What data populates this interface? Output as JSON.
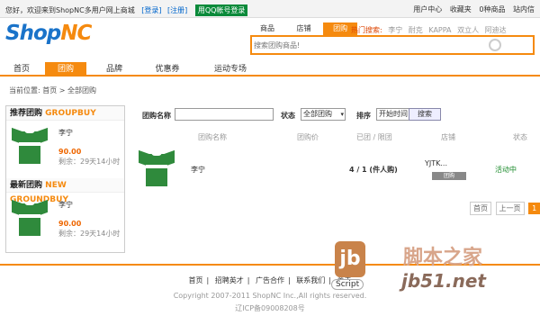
{
  "topbar": {
    "welcome": "您好，欢迎来到ShopNC多用户网上商城",
    "login": "[登录]",
    "register": "[注册]",
    "badge": "用QQ帐号登录",
    "right": [
      "用户中心",
      "收藏夹",
      "0种商品",
      "站内信"
    ]
  },
  "brand": {
    "logo_a": "Shop",
    "logo_b": "NC"
  },
  "search": {
    "tabs": [
      "商品",
      "店铺",
      "团购"
    ],
    "active_tab": "团购",
    "placeholder": "搜索团购商品!",
    "hot_label": "热门搜索:",
    "hot": [
      "李宁",
      "耐克",
      "KAPPA",
      "双立人",
      "阿迪达"
    ]
  },
  "nav": {
    "items": [
      "首页",
      "团购",
      "品牌",
      "优惠券",
      "运动专场"
    ],
    "active": "团购"
  },
  "crumb": "当前位置: 首页 > 全部团购",
  "sidebar": {
    "recommend": {
      "title": "推荐团购",
      "title_en": "GROUPBUY",
      "name": "李宁",
      "price": "90.00",
      "time": "剩余：29天14小时"
    },
    "latest": {
      "title": "最新团购",
      "title_en": "NEW GROUNDBUY",
      "name": "李宁",
      "price": "90.00",
      "time": "剩余：29天14小时"
    }
  },
  "filter": {
    "name_label": "团购名称",
    "status_label": "状态",
    "status_value": "全部团购",
    "sort_label": "排序",
    "sort_value": "开始时间",
    "search_button": "搜索"
  },
  "table": {
    "headers": [
      "团购名称",
      "团购价",
      "已团 / 限团",
      "店铺",
      "状态"
    ],
    "rows": [
      {
        "name": "李宁",
        "count": "4 / 1 (件人购)",
        "store": "YJTK...",
        "action": "团购",
        "status": "活动中"
      }
    ]
  },
  "pager": {
    "items": [
      "首页",
      "上一页"
    ],
    "current": "1"
  },
  "footer": {
    "links": [
      "首页",
      "招聘英才",
      "广告合作",
      "联系我们",
      "关于"
    ],
    "copyright": "Copyright 2007-2011 ShopNC Inc.,All rights reserved.",
    "icp": "辽ICP备09008208号"
  },
  "watermark": {
    "mark": "jb",
    "script": "Script",
    "cn": "脚本之家",
    "en": "jb51.net"
  }
}
